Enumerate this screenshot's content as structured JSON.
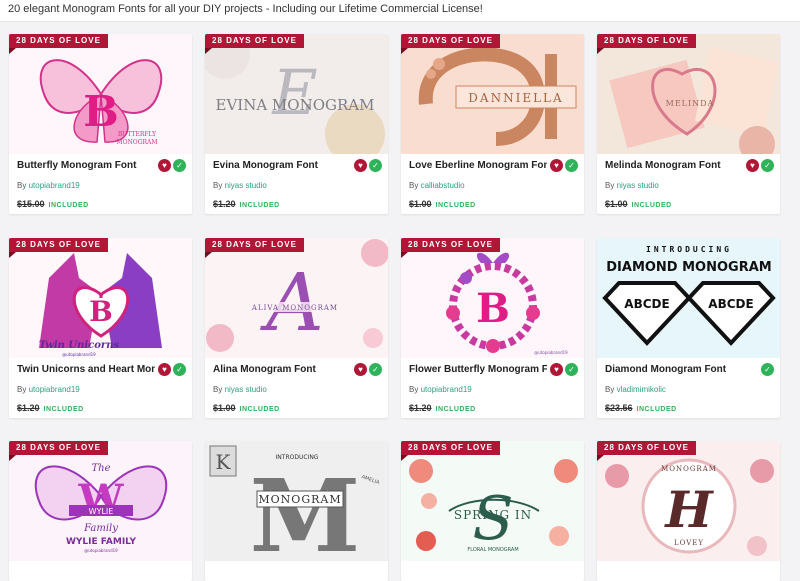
{
  "header": {
    "text": "20 elegant Monogram Fonts for all your DIY projects - Including our Lifetime Commercial License!"
  },
  "ribbon_label": "28 DAYS OF LOVE",
  "colors": {
    "ribbon": "#b01636",
    "included": "#2fb35a",
    "author": "#2f9e84",
    "heart": "#b01636"
  },
  "cards": [
    {
      "title": "Butterfly Monogram Font",
      "by": "By",
      "author": "utopiabrand19",
      "old_price": "$15.00",
      "included": "INCLUDED",
      "ribbon": true,
      "heart": true,
      "check": true,
      "art_text": [
        "B",
        "BUTTERFLY",
        "MONOGRAM"
      ]
    },
    {
      "title": "Evina Monogram Font",
      "by": "By",
      "author": "niyas studio",
      "old_price": "$1.20",
      "included": "INCLUDED",
      "ribbon": true,
      "heart": true,
      "check": true,
      "art_text": [
        "E",
        "EVINA MONOGRAM"
      ]
    },
    {
      "title": "Love Eberline Monogram Font",
      "by": "By",
      "author": "calliabstudio",
      "old_price": "$1.00",
      "included": "INCLUDED",
      "ribbon": true,
      "heart": true,
      "check": true,
      "art_text": [
        "DANNIELLA"
      ]
    },
    {
      "title": "Melinda Monogram Font",
      "by": "By",
      "author": "niyas studio",
      "old_price": "$1.00",
      "included": "INCLUDED",
      "ribbon": true,
      "heart": true,
      "check": true,
      "art_text": [
        "MELINDA"
      ]
    },
    {
      "title": "Twin Unicorns and Heart Monogram Font",
      "by": "By",
      "author": "utopiabrand19",
      "old_price": "$1.20",
      "included": "INCLUDED",
      "ribbon": true,
      "heart": true,
      "check": true,
      "art_text": [
        "B",
        "Twin Unicorns",
        "@utopiabrand19"
      ]
    },
    {
      "title": "Alina Monogram Font",
      "by": "By",
      "author": "niyas studio",
      "old_price": "$1.00",
      "included": "INCLUDED",
      "ribbon": true,
      "heart": true,
      "check": true,
      "art_text": [
        "A",
        "ALIVA MONOGRAM"
      ]
    },
    {
      "title": "Flower Butterfly Monogram Font",
      "by": "By",
      "author": "utopiabrand19",
      "old_price": "$1.20",
      "included": "INCLUDED",
      "ribbon": true,
      "heart": true,
      "check": true,
      "art_text": [
        "B",
        "@utopiabrand19"
      ]
    },
    {
      "title": "Diamond Monogram  Font",
      "by": "By",
      "author": "vladimimikolic",
      "old_price": "$23.56",
      "included": "INCLUDED",
      "ribbon": false,
      "heart": false,
      "check": true,
      "art_text": [
        "INTRODUCING",
        "DIAMOND MONOGRAM",
        "ABCDE"
      ]
    },
    {
      "title": "",
      "by": "",
      "author": "",
      "old_price": "",
      "included": "",
      "ribbon": true,
      "heart": false,
      "check": false,
      "art_text": [
        "W",
        "The",
        "WYLIE",
        "Family",
        "WYLIE FAMILY",
        "@utopiabrand19"
      ]
    },
    {
      "title": "",
      "by": "",
      "author": "",
      "old_price": "",
      "included": "",
      "ribbon": false,
      "heart": false,
      "check": false,
      "art_text": [
        "M",
        "INTRODUCING",
        "MONOGRAM",
        "K",
        "AMELIA"
      ]
    },
    {
      "title": "",
      "by": "",
      "author": "",
      "old_price": "",
      "included": "",
      "ribbon": true,
      "heart": false,
      "check": false,
      "art_text": [
        "S",
        "SPRING IN",
        "FLORAL MONOGRAM"
      ]
    },
    {
      "title": "",
      "by": "",
      "author": "",
      "old_price": "",
      "included": "",
      "ribbon": true,
      "heart": false,
      "check": false,
      "art_text": [
        "H",
        "MONOGRAM",
        "LOVEY"
      ]
    }
  ]
}
